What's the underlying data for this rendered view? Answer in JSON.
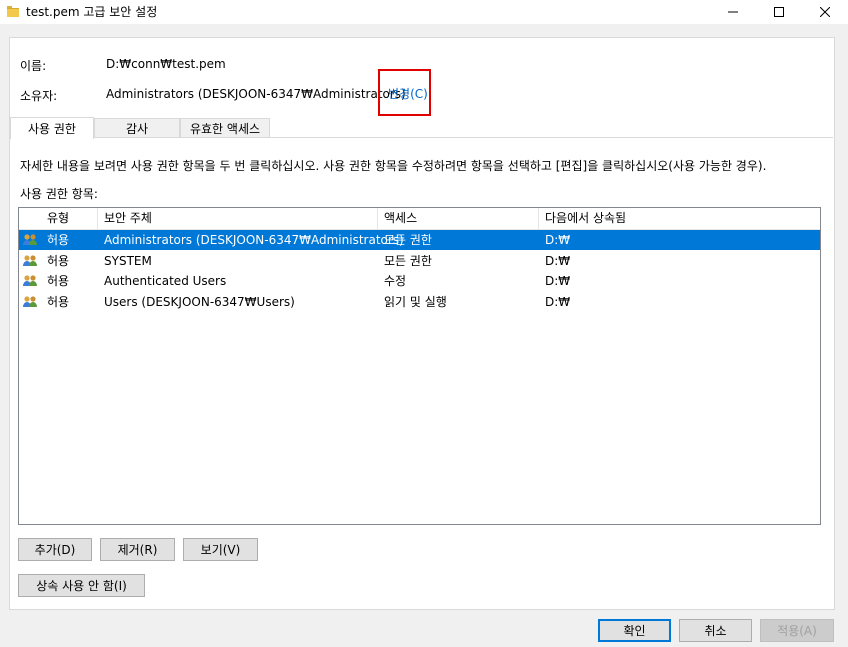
{
  "window": {
    "title": "test.pem 고급 보안 설정",
    "minimize_glyph": "—",
    "maximize_glyph": "☐",
    "close_glyph": "✕"
  },
  "info": {
    "name_label": "이름:",
    "name_value": "D:₩conn₩test.pem",
    "owner_label": "소유자:",
    "owner_value": "Administrators (DESKJOON-6347₩Administrators)",
    "change_link": "변경(C)"
  },
  "tabs": [
    {
      "label": "사용 권한",
      "active": true
    },
    {
      "label": "감사",
      "active": false
    },
    {
      "label": "유효한 액세스",
      "active": false
    }
  ],
  "description": "자세한 내용을 보려면 사용 권한 항목을 두 번 클릭하십시오. 사용 권한 항목을 수정하려면 항목을 선택하고 [편집]을 클릭하십시오(사용 가능한 경우).",
  "entries_label": "사용 권한 항목:",
  "table": {
    "columns": [
      "유형",
      "보안 주체",
      "액세스",
      "다음에서 상속됨"
    ],
    "rows": [
      {
        "type": "허용",
        "principal": "Administrators (DESKJOON-6347₩Administrators)",
        "access": "모든 권한",
        "inherited": "D:₩",
        "selected": true,
        "icon": "users-icon"
      },
      {
        "type": "허용",
        "principal": "SYSTEM",
        "access": "모든 권한",
        "inherited": "D:₩",
        "selected": false,
        "icon": "users-icon"
      },
      {
        "type": "허용",
        "principal": "Authenticated Users",
        "access": "수정",
        "inherited": "D:₩",
        "selected": false,
        "icon": "users-icon"
      },
      {
        "type": "허용",
        "principal": "Users (DESKJOON-6347₩Users)",
        "access": "읽기 및 실행",
        "inherited": "D:₩",
        "selected": false,
        "icon": "users-icon"
      }
    ]
  },
  "buttons": {
    "add": "추가(D)",
    "remove": "제거(R)",
    "view": "보기(V)",
    "disable_inheritance": "상속 사용 안 함(I)",
    "ok": "확인",
    "cancel": "취소",
    "apply": "적용(A)"
  },
  "colors": {
    "selection": "#0078d7",
    "link": "#0066cc",
    "highlight_box": "#e00000"
  }
}
